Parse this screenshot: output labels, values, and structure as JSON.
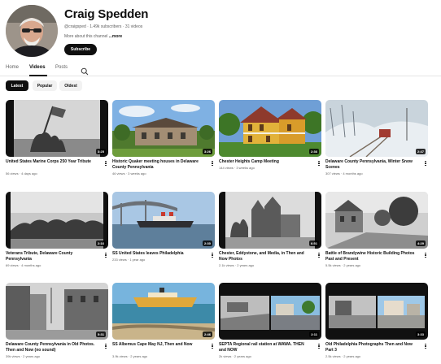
{
  "channel": {
    "name": "Craig Spedden",
    "meta": "@craigsped · 1.49k subscribers · 31 videos",
    "about_prefix": "More about this channel ",
    "about_more": "...more",
    "subscribe_label": "Subscribe"
  },
  "tabs": [
    {
      "label": "Home",
      "active": false
    },
    {
      "label": "Videos",
      "active": true
    },
    {
      "label": "Posts",
      "active": false
    }
  ],
  "search_icon": "search-icon",
  "chips": [
    {
      "label": "Latest",
      "active": true
    },
    {
      "label": "Popular",
      "active": false
    },
    {
      "label": "Oldest",
      "active": false
    }
  ],
  "videos": [
    {
      "title": "United States Marine Corps 250 Year Tribute",
      "meta": "56 views · 4 days ago",
      "duration": "3:25"
    },
    {
      "title": "Historic Quaker meeting houses in Delaware County Pennsylvania",
      "meta": "46 views · 3 weeks ago",
      "duration": "3:26"
    },
    {
      "title": "Chester Heights Camp Meeting",
      "meta": "144 views · 3 weeks ago",
      "duration": "2:36"
    },
    {
      "title": "Delaware County Pennsylvania, Winter Snow Scenes",
      "meta": "307 views · 4 months ago",
      "duration": "2:47"
    },
    {
      "title": "Veterans Tribute, Delaware County Pennsylvania",
      "meta": "69 views · 4 months ago",
      "duration": "2:16"
    },
    {
      "title": "SS United States leaves Philadelphia",
      "meta": "233 views · 1 year ago",
      "duration": "2:30"
    },
    {
      "title": "Chester, Eddystone, and Media, in Then and Now Photos",
      "meta": "2.1k views · 2 years ago",
      "duration": "6:51"
    },
    {
      "title": "Battle of Brandywine Historic Building Photos Past and Present",
      "meta": "5.5k views · 2 years ago",
      "duration": "4:29"
    },
    {
      "title": "Delaware County Pennsylvania in Old Photos. Then and Now (no sound)",
      "meta": "39k views · 2 years ago",
      "duration": "5:31"
    },
    {
      "title": "SS Albemus Cape May NJ, Then and Now",
      "meta": "3.9k views · 2 years ago",
      "duration": "2:46"
    },
    {
      "title": "SEPTA Regional rail station at WAWA. THEN and NOW",
      "meta": "2k views · 2 years ago",
      "duration": "2:11"
    },
    {
      "title": "Old Philadelphia Photographs Then and Now Part 3",
      "meta": "2.5k views · 2 years ago",
      "duration": "3:33"
    }
  ]
}
